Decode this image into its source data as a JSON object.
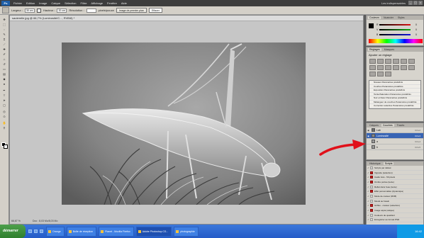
{
  "menubar": {
    "logo": "Ps",
    "items": [
      "Fichier",
      "Edition",
      "Image",
      "Calque",
      "Sélection",
      "Filtre",
      "Affichage",
      "Fenêtre",
      "Aide"
    ],
    "workspace": "Les indispensables",
    "min": "_",
    "max": "□",
    "close": "×"
  },
  "options": {
    "width_label": "Largeur :",
    "width_value": "30 cm",
    "height_label": "Hauteur :",
    "height_value": "20 cm",
    "resolution_label": "Résolution :",
    "resolution_value": "",
    "resolution_unit": "pixels/pouce",
    "front_button": "Image de premier plan",
    "clear_button": "Effacer"
  },
  "document": {
    "title": "sauterelle.jpg @ 66,7% (Luminosité/C..., RVB/8) *",
    "zoom": "66,67 %",
    "status": "Doc : 8,03 Mo/8,03 Mo"
  },
  "color_panel": {
    "tabs": [
      "Couleurs",
      "Nuancier",
      "Styles"
    ],
    "sliders": [
      {
        "letter": "R",
        "value": "0",
        "color": "#d11"
      },
      {
        "letter": "V",
        "value": "0",
        "color": "#1a1"
      },
      {
        "letter": "B",
        "value": "0",
        "color": "#11d"
      }
    ]
  },
  "adjustments": {
    "tabs": [
      "Réglages",
      "Masques"
    ],
    "heading": "Ajouter un réglage",
    "presets": [
      "Niveaux Paramètres prédéfinis",
      "Courbes Paramètres prédéfinis",
      "Exposition Paramètres prédéfinis",
      "Teinte/Saturation Paramètres prédéfinis",
      "Noir et blanc Paramètres prédéfinis",
      "Mélangeur de couches Paramètres prédéfinis",
      "Correction sélective Paramètres prédéfinis"
    ]
  },
  "layers": {
    "tabs": [
      "Calques",
      "Couches",
      "Tracés"
    ],
    "rows": [
      {
        "name": "Lab",
        "shortcut": "Ctrl+2",
        "selected": false,
        "thumb": "#6e6e6e"
      },
      {
        "name": "Luminosité",
        "shortcut": "Ctrl+3",
        "selected": true,
        "thumb": "#888888"
      },
      {
        "name": "a",
        "shortcut": "Ctrl+4",
        "selected": false,
        "thumb": "#9a9a9a"
      },
      {
        "name": "b",
        "shortcut": "Ctrl+5",
        "selected": false,
        "thumb": "#9a9a9a"
      }
    ]
  },
  "history": {
    "tabs": [
      "Historique",
      "Scripts"
    ],
    "rows": [
      {
        "label": "Scripts par défaut",
        "red": false
      },
      {
        "label": "Vignette (sélection)",
        "red": true
      },
      {
        "label": "Cadre bois - 50 pixels",
        "red": true
      },
      {
        "label": "Ombre portée (texte)",
        "red": true
      },
      {
        "label": "Reflet dans l'eau (texte)",
        "red": false
      },
      {
        "label": "Effet personnalisé (dynamique)",
        "red": true
      },
      {
        "label": "Mode de couleur (RVB)",
        "red": false
      },
      {
        "label": "Moulé au fusain",
        "red": false
      },
      {
        "label": "Griffes - couleur (sélection)",
        "red": true
      },
      {
        "label": "Image sépia (calque)",
        "red": true
      },
      {
        "label": "Couleurs de quadrant",
        "red": false
      },
      {
        "label": "Enregistrer au format PSD",
        "red": false
      }
    ]
  },
  "taskbar": {
    "start": "démarrer",
    "tasks": [
      {
        "label": "Orange",
        "active": false
      },
      {
        "label": "Boîte de réception",
        "active": false
      },
      {
        "label": "Planet - Mozilla Firefox",
        "active": false
      },
      {
        "label": "Adobe Photoshop CS...",
        "active": true
      },
      {
        "label": "photographie",
        "active": false
      }
    ],
    "clock": "16:42"
  },
  "colors": {
    "accent_selected": "#3864b4",
    "annotation_arrow": "#e0101a"
  }
}
